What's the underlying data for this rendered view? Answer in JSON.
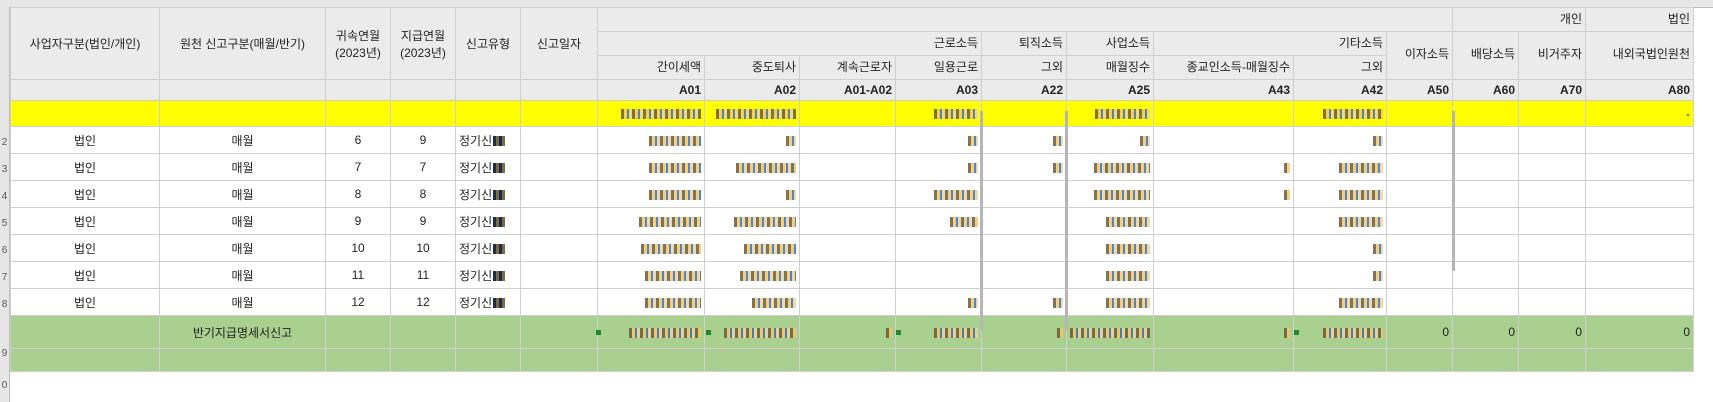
{
  "header": {
    "col_a": "사업자구분(법인/개인)",
    "col_b": "원천 신고구분(매월/반기)",
    "col_c": [
      "귀속연월",
      "(2023년)"
    ],
    "col_d": [
      "지급연월",
      "(2023년)"
    ],
    "col_e": "신고유형",
    "col_f": "신고일자",
    "groups": {
      "personal": "개인",
      "corporate": "법인",
      "labor": "근로소득",
      "retirement": "퇴직소득",
      "business": "사업소득",
      "other": "기타소득"
    },
    "sub": {
      "simple": "간이세액",
      "midterm": "중도퇴사",
      "continued": "계속근로자",
      "daily": "일용근로",
      "ret_other": "그외",
      "monthly": "매월징수",
      "religious": "종교인소득-매월징수",
      "oth_other": "그외",
      "interest": "이자소득",
      "dividend": "배당소득",
      "nonresident": "비거주자",
      "domestic_corp": "내외국법인원천"
    },
    "codes": {
      "a01": "A01",
      "a02": "A02",
      "a01_a02": "A01-A02",
      "a03": "A03",
      "a22": "A22",
      "a25": "A25",
      "a43": "A43",
      "a42": "A42",
      "a50": "A50",
      "a60": "A60",
      "a70": "A70",
      "a80": "A80"
    }
  },
  "row_numbers": [
    "2",
    "3",
    "4",
    "5",
    "6",
    "7",
    "8",
    "9",
    "0"
  ],
  "yellow_row": {
    "a80": "-"
  },
  "rows": [
    {
      "type": "법인",
      "period": "매월",
      "belong": "6",
      "pay": "9",
      "kind": "정기신"
    },
    {
      "type": "법인",
      "period": "매월",
      "belong": "7",
      "pay": "7",
      "kind": "정기신"
    },
    {
      "type": "법인",
      "period": "매월",
      "belong": "8",
      "pay": "8",
      "kind": "정기신"
    },
    {
      "type": "법인",
      "period": "매월",
      "belong": "9",
      "pay": "9",
      "kind": "정기신"
    },
    {
      "type": "법인",
      "period": "매월",
      "belong": "10",
      "pay": "10",
      "kind": "정기신"
    },
    {
      "type": "법인",
      "period": "매월",
      "belong": "11",
      "pay": "11",
      "kind": "정기신"
    },
    {
      "type": "법인",
      "period": "매월",
      "belong": "12",
      "pay": "12",
      "kind": "정기신"
    }
  ],
  "total_row": {
    "label": "반기지급명세서신고",
    "a50": "0",
    "a60": "0",
    "a70": "0",
    "a80": "0"
  }
}
